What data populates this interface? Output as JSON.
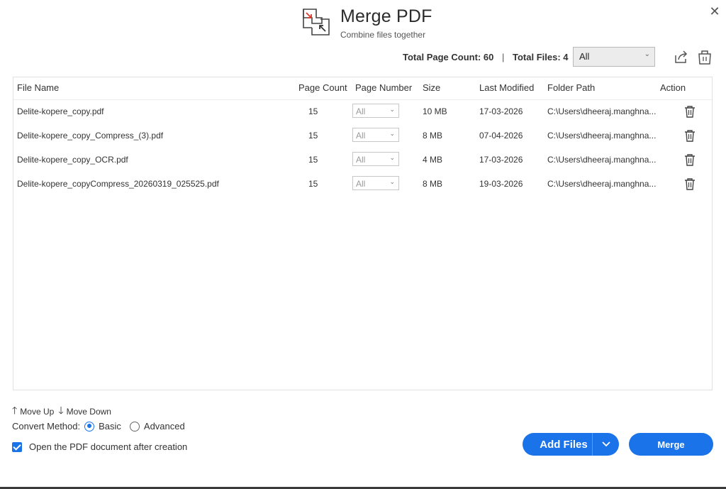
{
  "header": {
    "title": "Merge PDF",
    "subtitle": "Combine files together",
    "logo_icon": "merge-pdf-logo-icon",
    "close_icon": "close-icon",
    "close_glyph": "✕"
  },
  "summary": {
    "page_count_label": "Total Page Count:",
    "page_count_value": "60",
    "separator": "|",
    "files_label": "Total Files:",
    "files_value": "4",
    "filter_selected": "All",
    "share_icon": "share-export-icon",
    "clear_icon": "clear-list-icon"
  },
  "table": {
    "columns": [
      "File Name",
      "Page Count",
      "Page Number",
      "Size",
      "Last Modified",
      "Folder Path",
      "Action"
    ],
    "rows": [
      {
        "name": "Delite-kopere_copy.pdf",
        "page_count": "15",
        "page_number": "All",
        "size": "10 MB",
        "modified": "17-03-2026",
        "folder": "C:\\Users\\dheeraj.manghna..."
      },
      {
        "name": "Delite-kopere_copy_Compress_(3).pdf",
        "page_count": "15",
        "page_number": "All",
        "size": "8 MB",
        "modified": "07-04-2026",
        "folder": "C:\\Users\\dheeraj.manghna..."
      },
      {
        "name": "Delite-kopere_copy_OCR.pdf",
        "page_count": "15",
        "page_number": "All",
        "size": "4 MB",
        "modified": "17-03-2026",
        "folder": "C:\\Users\\dheeraj.manghna..."
      },
      {
        "name": "Delite-kopere_copyCompress_20260319_025525.pdf",
        "page_count": "15",
        "page_number": "All",
        "size": "8 MB",
        "modified": "19-03-2026",
        "folder": "C:\\Users\\dheeraj.manghna..."
      }
    ],
    "action_icon": "trash-icon"
  },
  "controls": {
    "move_up": "Move Up",
    "move_down": "Move Down",
    "up_arrow": "🡑",
    "down_arrow": "🡓",
    "convert_label": "Convert Method:",
    "convert_options": [
      "Basic",
      "Advanced"
    ],
    "convert_selected": "Basic",
    "open_after_label": "Open the PDF document after creation",
    "open_after_checked": true
  },
  "buttons": {
    "add_files": "Add Files",
    "merge": "Merge"
  },
  "colors": {
    "accent": "#1a73e8",
    "logo_arrow": "#d9392b"
  }
}
